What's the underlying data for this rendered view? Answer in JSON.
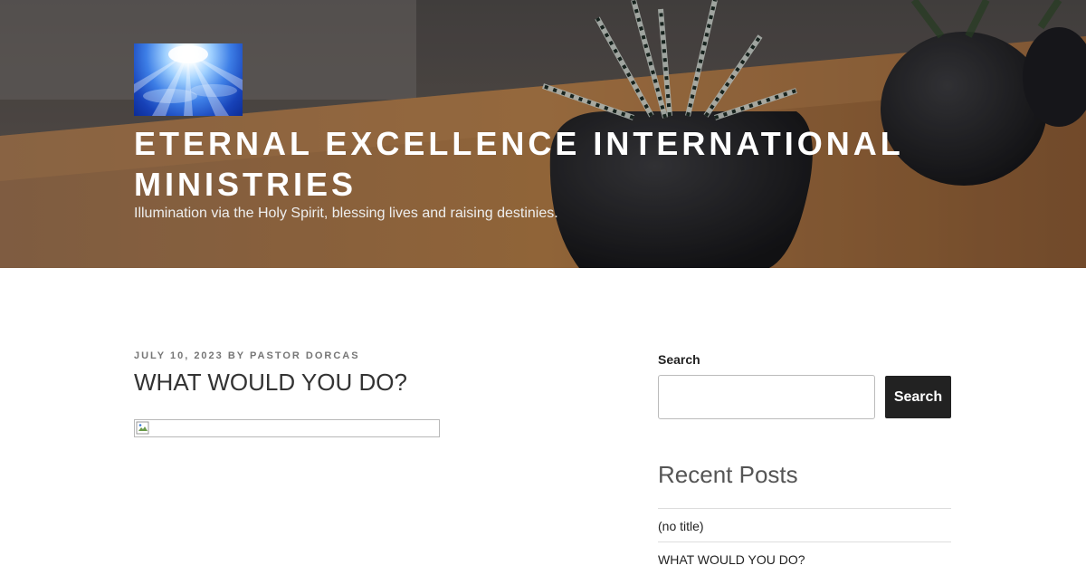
{
  "header": {
    "logo_alt": "Site logo",
    "title": "ETERNAL EXCELLENCE INTERNATIONAL MINISTRIES",
    "tagline": "Illumination via the Holy Spirit, blessing lives and raising destinies."
  },
  "post": {
    "date": "JULY 10, 2023",
    "by": "BY",
    "author": "PASTOR DORCAS",
    "title": "WHAT WOULD YOU DO?"
  },
  "sidebar": {
    "search_label": "Search",
    "search_value": "",
    "search_button": "Search",
    "recent_title": "Recent Posts",
    "recent_posts": [
      "(no title)",
      "WHAT WOULD YOU DO?"
    ]
  },
  "colors": {
    "button_bg": "#222222",
    "title_text": "#ffffff"
  }
}
